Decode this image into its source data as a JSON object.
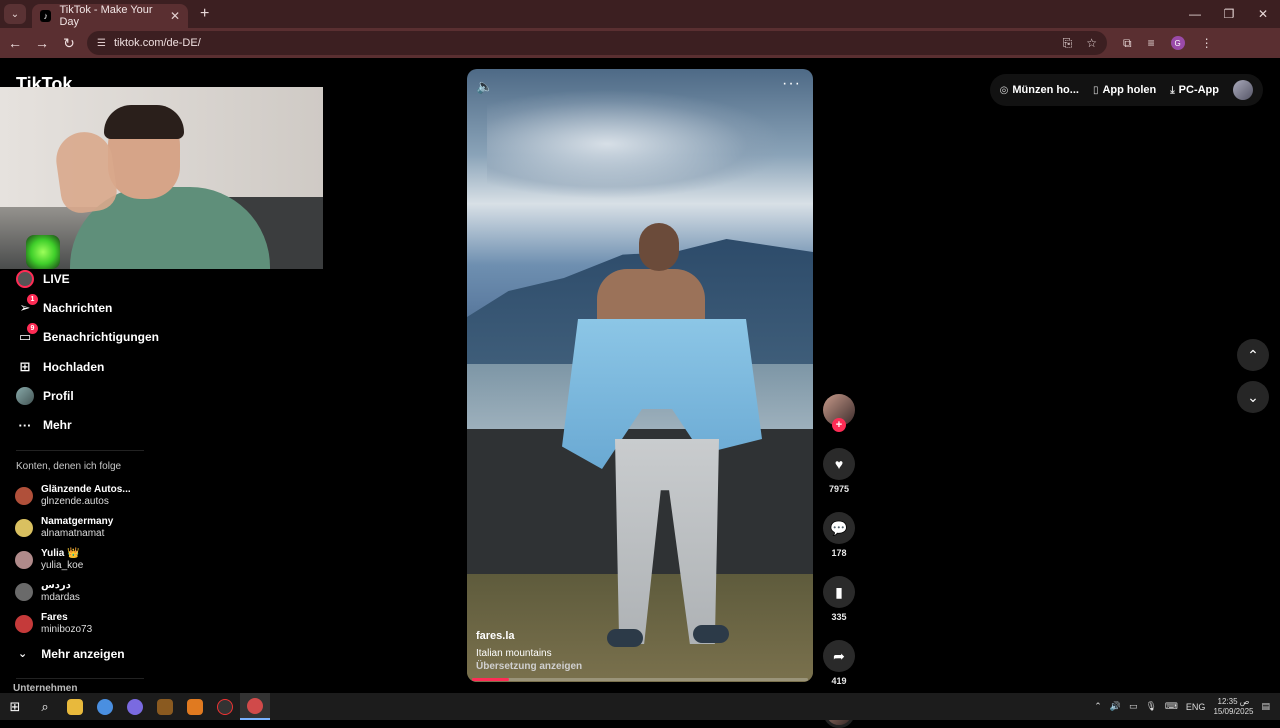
{
  "browser": {
    "tab_title": "TikTok - Make Your Day",
    "tab_icon": "tiktok-icon",
    "url": "tiktok.com/de-DE/"
  },
  "logo": "TikTok",
  "nav": {
    "items": [
      {
        "label": "LIVE",
        "icon": "live-icon",
        "badge": ""
      },
      {
        "label": "Nachrichten",
        "icon": "send-icon",
        "badge": "1"
      },
      {
        "label": "Benachrichtigungen",
        "icon": "inbox-icon",
        "badge": "9"
      },
      {
        "label": "Hochladen",
        "icon": "plus-square-icon",
        "badge": ""
      },
      {
        "label": "Profil",
        "icon": "avatar-icon",
        "badge": ""
      },
      {
        "label": "Mehr",
        "icon": "more-dots-icon",
        "badge": ""
      }
    ]
  },
  "following": {
    "title": "Konten, denen ich folge",
    "accounts": [
      {
        "name": "Glänzende Autos...",
        "user": "glnzende.autos",
        "color": "#b0503a"
      },
      {
        "name": "Namatgermany",
        "user": "alnamatnamat",
        "color": "#d9c060"
      },
      {
        "name": "Yulia 👑",
        "user": "yulia_koe",
        "color": "#b08a8a"
      },
      {
        "name": "دردس",
        "user": "mdardas",
        "color": "#6a6a6a"
      },
      {
        "name": "Fares",
        "user": "minibozo73",
        "color": "#c53a3a"
      }
    ],
    "show_more": "Mehr anzeigen"
  },
  "footer_section": "Unternehmen",
  "video": {
    "author": "fares.la",
    "caption": "Italian mountains",
    "translate": "Übersetzung anzeigen",
    "progress": 0.11
  },
  "actions": {
    "likes": "7975",
    "comments": "178",
    "saves": "335",
    "shares": "419"
  },
  "top_right": {
    "coins": "Münzen ho...",
    "app": "App holen",
    "pc_app": "PC-App"
  },
  "taskbar": {
    "lang": "ENG",
    "time": "12:35 ص",
    "date": "15/09/2025"
  }
}
